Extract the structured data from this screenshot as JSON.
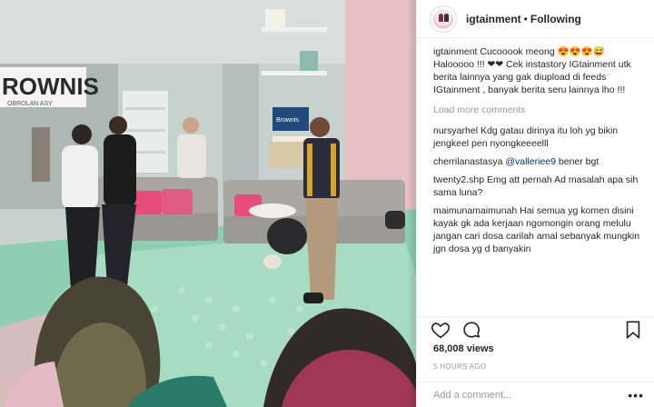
{
  "post": {
    "username": "igtainment",
    "separator": "•",
    "follow_status": "Following",
    "caption": {
      "username": "igtainment",
      "text": "Cucooook meong 😍😍😍😅 Halooooo !!! ❤❤ Cek instastory IGtainment utk berita lainnya yang gak diupload di feeds IGtainment , banyak berita seru lainnya lho !!!"
    },
    "load_more": "Load more comments",
    "comments": [
      {
        "username": "nursyarhel",
        "text": "Kdg gatau dirinya itu loh yg bikin jengkeel pen nyongkeeeelll"
      },
      {
        "username": "cherrilanastasya",
        "mention": "@vallerieе9",
        "text": "bener bgt"
      },
      {
        "username": "twenty2.shp",
        "text": "Emg att pernah Ad masalah apa sih sama luna?"
      },
      {
        "username": "maimunamaimunah",
        "text": "Hai semua yg komen disini kayak gk ada kerjaan ngomongin orang melulu jangan cari dosa carilah amal sebanyak mungkin jgn dosa yg d banyakin"
      }
    ],
    "views": "68,008 views",
    "time_ago": "5 HOURS AGO",
    "add_comment_placeholder": "Add a comment...",
    "more_glyph": "•••"
  },
  "studio": {
    "sign_text": "ROWNIS",
    "sign_subtext": "OBROLAN ASY",
    "screen_text": "Brownis"
  },
  "icons": {
    "like": "heart-icon",
    "comment": "speech-bubble-icon",
    "save": "bookmark-icon",
    "options": "ellipsis-icon"
  },
  "colors": {
    "link": "#003569",
    "muted": "#999999",
    "text": "#262626"
  }
}
